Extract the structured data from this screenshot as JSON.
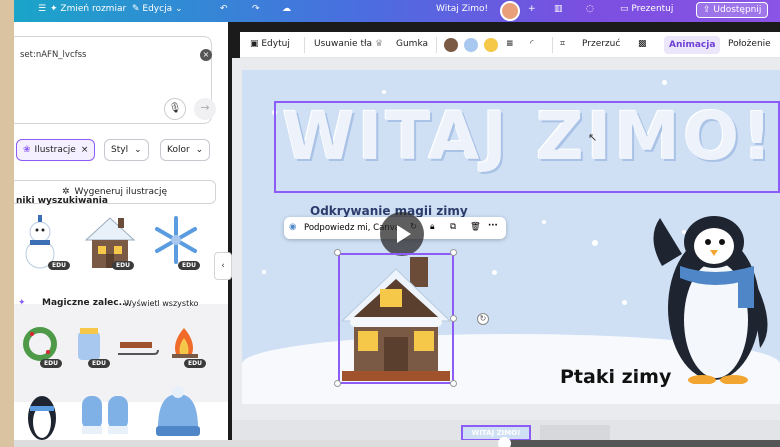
{
  "topbar": {
    "resize": "Zmień rozmiar",
    "edit": "Edycja",
    "doc_title": "Witaj Zimo!",
    "present": "Prezentuj",
    "share": "Udostępnij"
  },
  "panel": {
    "search_value": "set:nAFN_lvcfss",
    "chips": [
      {
        "label": "Ilustracje",
        "active": true
      },
      {
        "label": "Styl",
        "active": false
      },
      {
        "label": "Kolor",
        "active": false
      }
    ],
    "generate_label": "Wygeneruj ilustrację",
    "results_title": "niki wyszukiwania",
    "badge": "EDU",
    "magic_title": "Magiczne zalec...",
    "see_all": "Wyświetl wszystko"
  },
  "toolbar": {
    "edit": "Edytuj",
    "bg_remove": "Usuwanie tła",
    "eraser": "Gumka",
    "crop": "Przerzuć",
    "animation": "Animacja",
    "position": "Położenie",
    "swatches": [
      "#7a5a45",
      "#a9c8ef",
      "#f5c84a"
    ]
  },
  "canvas": {
    "title": "WITAJ ZIMO!",
    "subtitle": "Odkrywanie magii zimy",
    "floating_bar_label": "Podpowiedz mi, Canva",
    "birds_label": "Ptaki zimy",
    "page_thumb_label": "WITAJ ZIMO!"
  },
  "video": {
    "progress": 0.64
  },
  "colors": {
    "accent": "#8b5cf6",
    "slide_bg": "#cfe0f5"
  }
}
